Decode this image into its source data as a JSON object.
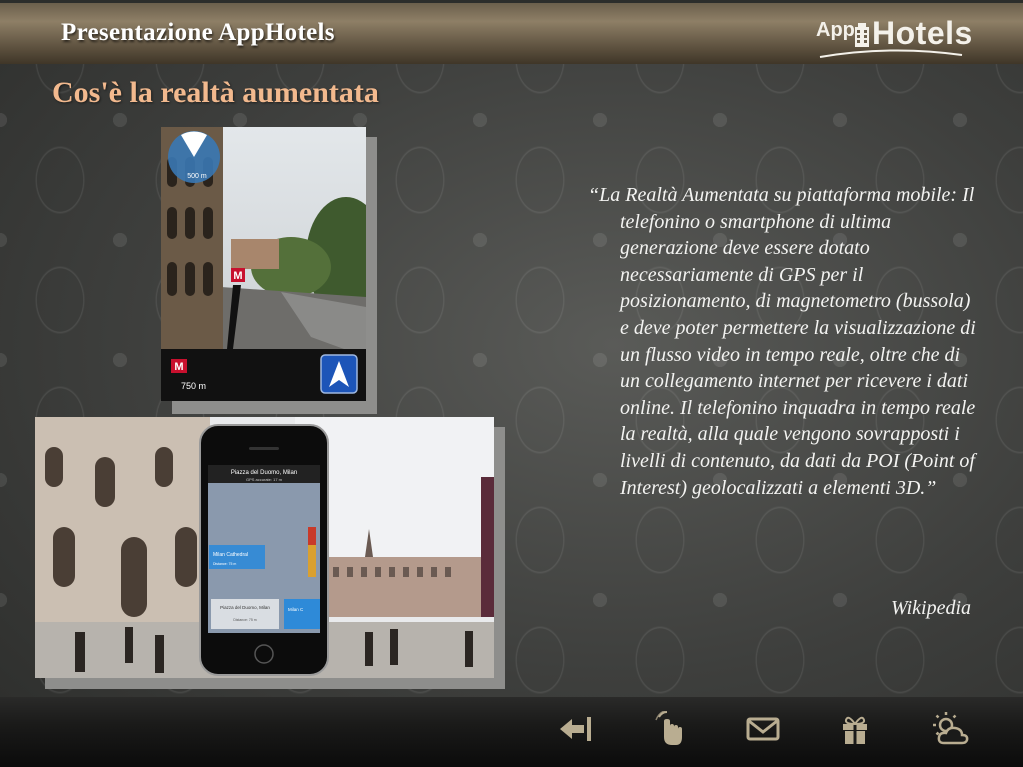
{
  "header": {
    "title": "Presentazione AppHotels",
    "logo_app": "App",
    "logo_hotels": "Hotels"
  },
  "slide": {
    "title": "Cos'è la realtà aumentata",
    "quote": "“La Realtà Aumentata su piattaforma mobile: Il telefonino o smartphone di ultima generazione deve essere dotato necessariamente di GPS per il posizionamento, di magnetometro (bussola) e deve poter permettere la visualizzazione di un flusso video in tempo reale, oltre che di un collegamento internet per ricevere i dati online. Il telefonino inquadra in tempo reale la realtà, alla quale vengono sovrapposti i livelli di contenuto, da dati da POI (Point of Interest) geolocalizzati a elementi 3D.”",
    "source": "Wikipedia"
  },
  "photo1": {
    "radar_distance": "500 m",
    "poi_badge": "M",
    "bottom_distance": "750 m"
  },
  "photo2": {
    "phone_header": "Piazza del Duomo, Milan",
    "phone_subheader": "GPS accurate: 17 m",
    "poi_label": "Milan Cathedral",
    "poi_distance": "Distance: 75 m",
    "card_left": "Piazza del Duomo, Milan",
    "card_left_dist": "Distance: 75 m",
    "card_right": "Milan C"
  },
  "footer": {
    "icons": [
      "exit-icon",
      "touch-hand-icon",
      "mail-icon",
      "gift-icon",
      "weather-icon"
    ]
  },
  "colors": {
    "title_accent": "#f2b98e",
    "icon_tint": "#b9ad91"
  }
}
